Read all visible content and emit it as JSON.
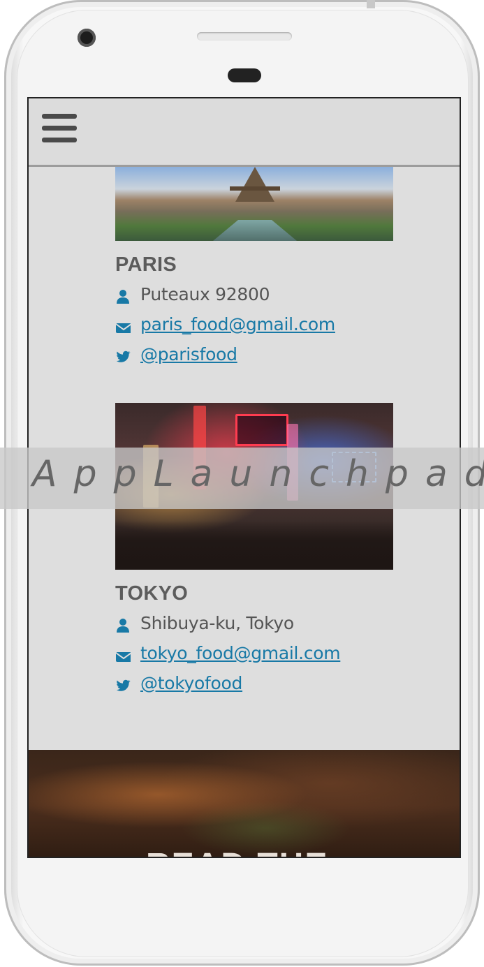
{
  "watermark": "AppLaunchpad",
  "menu": {
    "icon": "hamburger-menu-icon"
  },
  "cities": [
    {
      "name": "PARIS",
      "address": "Puteaux 92800",
      "email": "paris_food@gmail.com",
      "twitter": "@parisfood"
    },
    {
      "name": "TOKYO",
      "address": "Shibuya-ku, Tokyo",
      "email": "tokyo_food@gmail.com",
      "twitter": "@tokyofood"
    }
  ],
  "icons": {
    "address": "user-icon",
    "email": "envelope-icon",
    "twitter": "twitter-icon"
  },
  "footer": {
    "title": "READ THE"
  },
  "colors": {
    "link": "#1879a6",
    "icon": "#1879a6",
    "heading": "#5c5c5c",
    "screen_bg": "#dedede"
  }
}
